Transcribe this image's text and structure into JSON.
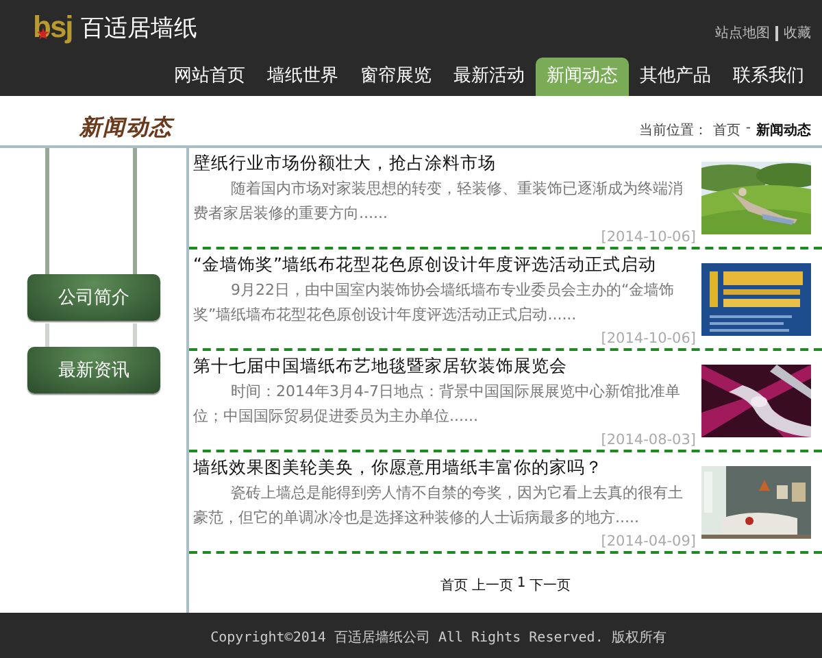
{
  "header": {
    "logo_text": "bsj",
    "brand": "百适居墙纸",
    "top_links": [
      "站点地图",
      "收藏"
    ],
    "nav": [
      {
        "label": "网站首页",
        "selected": false
      },
      {
        "label": "墙纸世界",
        "selected": false
      },
      {
        "label": "窗帘展览",
        "selected": false
      },
      {
        "label": "最新活动",
        "selected": false
      },
      {
        "label": "新闻动态",
        "selected": true
      },
      {
        "label": "其他产品",
        "selected": false
      },
      {
        "label": "联系我们",
        "selected": false
      }
    ]
  },
  "section": {
    "title": "新闻动态",
    "breadcrumb_label": "当前位置：",
    "breadcrumb": [
      "首页",
      "新闻动态"
    ],
    "separator": "-"
  },
  "sidebar": {
    "items": [
      "公司简介",
      "最新资讯"
    ]
  },
  "news": [
    {
      "title": "壁纸行业市场份额壮大，抢占涂料市场",
      "summary": "随着国内市场对家装思想的转变，轻装修、重装饰已逐渐成为终端消费者家居装修的重要方向......",
      "date": "[2014-10-06]",
      "kind": "picture"
    },
    {
      "title": "“金墙饰奖”墙纸布花型花色原创设计年度评选活动正式启动",
      "summary": "9月22日，由中国室内装饰协会墙纸墙布专业委员会主办的“金墙饰奖”墙纸墙布花型花色原创设计年度评选活动正式启动......",
      "date": "[2014-10-06]",
      "kind": "picture"
    },
    {
      "title": "第十七届中国墙纸布艺地毯暨家居软装饰展览会",
      "summary": "时间：2014年3月4-7日地点：背景中国国际展展览中心新馆批准单位；中国国际贸易促进委员为主办单位......",
      "date": "[2014-08-03]",
      "kind": "picture"
    },
    {
      "title": "墙纸效果图美轮美奂，你愿意用墙纸丰富你的家吗？",
      "summary": "瓷砖上墙总是能得到旁人情不自禁的夸奖，因为它看上去真的很有土豪范，但它的单调冰冷也是选择这种装修的人士诟病最多的地方.....",
      "date": "[2014-04-09]",
      "kind": "picture"
    }
  ],
  "pagination": [
    "首页",
    "上一页",
    "1",
    "下一页"
  ],
  "footer": {
    "copyright": "Copyright©2014 百适居墙纸公司 All Rights Reserved. 版权所有"
  }
}
